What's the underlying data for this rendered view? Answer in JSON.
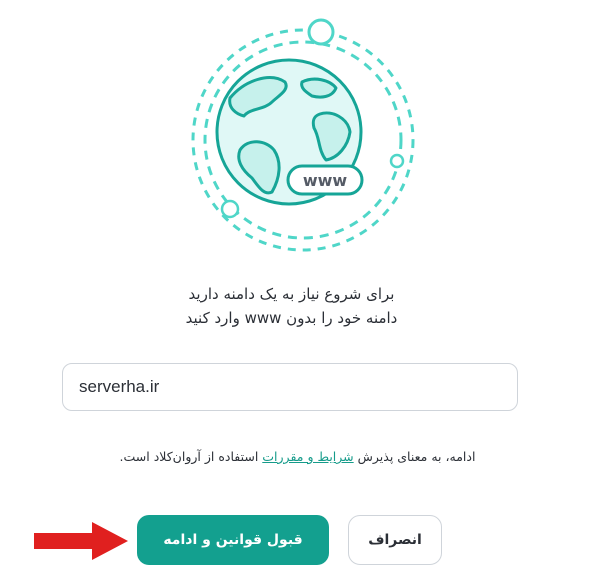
{
  "intro": {
    "line1": "برای شروع نیاز به یک دامنه دارید",
    "line2": "دامنه خود را بدون www وارد کنید"
  },
  "illustration": {
    "badge_text": "www"
  },
  "domain_input": {
    "value": "serverha.ir"
  },
  "consent": {
    "prefix": "ادامه، به معنای پذیرش ",
    "link_text": "شرایط و مقررات",
    "suffix": " استفاده از آروان‌کلاد است."
  },
  "buttons": {
    "accept_label": "قبول قوانین و ادامه",
    "cancel_label": "انصراف"
  },
  "colors": {
    "accent": "#13a08f",
    "globe_stroke": "#16a597",
    "ring": "#4fd6c8",
    "arrow": "#e0201f"
  }
}
